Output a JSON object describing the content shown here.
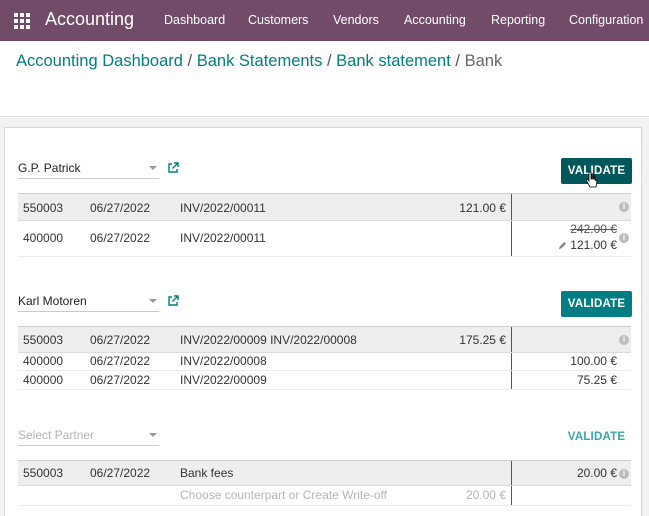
{
  "navbar": {
    "app_name": "Accounting",
    "menu": [
      "Dashboard",
      "Customers",
      "Vendors",
      "Accounting",
      "Reporting",
      "Configuration"
    ]
  },
  "breadcrumb": {
    "items": [
      "Accounting Dashboard",
      "Bank Statements",
      "Bank statement"
    ],
    "active": "Bank",
    "separator": "/"
  },
  "reconciliation": [
    {
      "partner": "G.P. Patrick",
      "validate_label": "VALIDATE",
      "header_line": {
        "account": "550003",
        "date": "06/27/2022",
        "label": "INV/2022/00011",
        "amount": "121.00 €"
      },
      "lines": [
        {
          "account": "400000",
          "date": "06/27/2022",
          "label": "INV/2022/00011",
          "original": "242.00 €",
          "amount": "121.00 €"
        }
      ]
    },
    {
      "partner": "Karl Motoren",
      "validate_label": "VALIDATE",
      "header_line": {
        "account": "550003",
        "date": "06/27/2022",
        "label": "INV/2022/00009 INV/2022/00008",
        "amount": "175.25 €"
      },
      "lines": [
        {
          "account": "400000",
          "date": "06/27/2022",
          "label": "INV/2022/00008",
          "amount": "100.00 €"
        },
        {
          "account": "400000",
          "date": "06/27/2022",
          "label": "INV/2022/00009",
          "amount": "75.25 €"
        }
      ]
    },
    {
      "partner_placeholder": "Select Partner",
      "validate_label": "VALIDATE",
      "header_line": {
        "account": "550003",
        "date": "06/27/2022",
        "label": "Bank fees",
        "amount": "20.00 €"
      },
      "open_line": {
        "label": "Choose counterpart or Create Write-off",
        "amount": "20.00 €"
      }
    }
  ],
  "colors": {
    "navbar": "#714b67",
    "accent": "#017e84",
    "accent_hover": "#01585c"
  },
  "icons": [
    "apps-grid-icon",
    "external-link-icon",
    "info-icon",
    "pencil-icon",
    "mouse-cursor-icon"
  ]
}
